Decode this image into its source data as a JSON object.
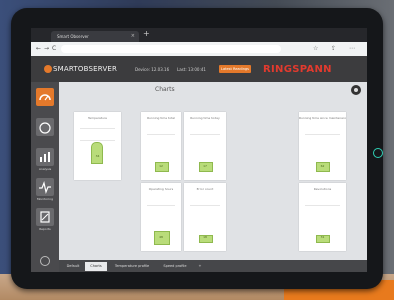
{
  "browser": {
    "tab_title": "Smart Observer",
    "tab_close": "×",
    "new_tab": "+",
    "back": "←",
    "forward": "→",
    "reload": "C"
  },
  "header": {
    "app_name": "SMARTOBSERVER",
    "info_1": "Device: 12.03.16",
    "info_2": "Last: 13:00:41",
    "action_button": "Latest Readings",
    "brand": "RINGSPANN"
  },
  "sidebar": {
    "items": [
      {
        "label": "",
        "icon": "speedometer-icon",
        "active": true
      },
      {
        "label": "",
        "icon": "gauge-icon",
        "active": false
      },
      {
        "label": "Analysis",
        "icon": "chart-icon",
        "active": false
      },
      {
        "label": "Monitoring",
        "icon": "pulse-icon",
        "active": false
      },
      {
        "label": "Reports",
        "icon": "report-icon",
        "active": false
      }
    ]
  },
  "main": {
    "title": "Charts",
    "panels": [
      {
        "title": "Temperature",
        "value": "34"
      },
      {
        "title": "Running time total",
        "value": "12"
      },
      {
        "title": "Running time today",
        "value": "17"
      },
      {
        "title": "Operating hours",
        "value": "48"
      },
      {
        "title": "Error count",
        "value": "18"
      },
      {
        "title": "Cycle count",
        "value": "28"
      },
      {
        "title": "Running time since maintenance",
        "value": "62"
      },
      {
        "title": "Revolutions",
        "value": "31"
      }
    ]
  },
  "bottom_tabs": [
    "Default",
    "Charts",
    "Temperature profile",
    "Speed profile",
    "+"
  ],
  "colors": {
    "accent": "#e4792b",
    "brand": "#e23a2e",
    "bar_fill": "#b9dc7a",
    "header": "#3c3c3e",
    "sidebar": "#4a4a4d"
  }
}
